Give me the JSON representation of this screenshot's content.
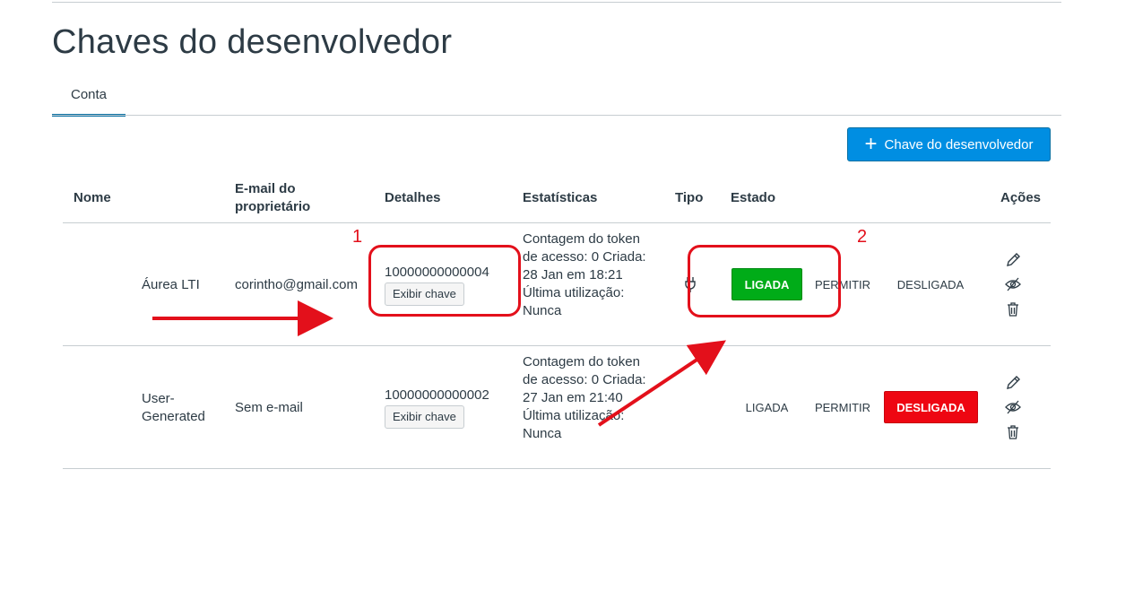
{
  "page": {
    "title": "Chaves do desenvolvedor"
  },
  "tabs": [
    {
      "label": "Conta",
      "active": true
    }
  ],
  "toolbar": {
    "add_key_label": "Chave do desenvolvedor",
    "add_key_color": "#008ee2"
  },
  "table": {
    "headers": {
      "name": "Nome",
      "owner_email": "E-mail do proprietário",
      "details": "Detalhes",
      "stats": "Estatísticas",
      "type": "Tipo",
      "state": "Estado",
      "actions": "Ações"
    },
    "rows": [
      {
        "name": "Áurea LTI",
        "email": "corintho@gmail.com",
        "key_id": "10000000000004",
        "show_key_label": "Exibir chave",
        "stats": "Contagem do token de acesso: 0 Criada: 28 Jan em 18:21 Última utilização: Nunca",
        "type_icon": "plug-icon",
        "state_on": "LIGADA",
        "state_allow": "PERMITIR",
        "state_off": "DESLIGADA",
        "selected_state": "LIGADA"
      },
      {
        "name": "User-Generated",
        "email": "Sem e-mail",
        "key_id": "10000000000002",
        "show_key_label": "Exibir chave",
        "stats": "Contagem do token de acesso: 0 Criada: 27 Jan em 21:40 Última utilização: Nunca",
        "type_icon": "",
        "state_on": "LIGADA",
        "state_allow": "PERMITIR",
        "state_off": "DESLIGADA",
        "selected_state": "DESLIGADA"
      }
    ]
  },
  "colors": {
    "on": "#00ac18",
    "off": "#ee0612",
    "annotation": "#e3101b",
    "tab_accent": "#0770a3"
  },
  "annotations": [
    {
      "label": "1"
    },
    {
      "label": "2"
    }
  ]
}
